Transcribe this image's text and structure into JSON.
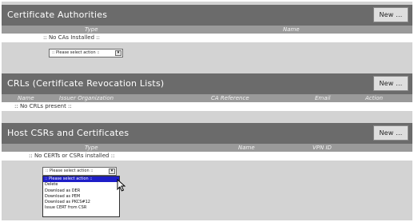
{
  "ca_section": {
    "title": "Certificate Authorities",
    "new_button": "New ...",
    "columns": [
      "Type",
      "Name"
    ],
    "empty_message": ":: No CAs Installed ::",
    "select_value": ":: Please select action ::"
  },
  "crl_section": {
    "title": "CRLs (Certificate Revocation Lists)",
    "new_button": "New ...",
    "columns": [
      "Name",
      "Issuer Organization",
      "CA Reference",
      "Email",
      "Action"
    ],
    "empty_message": ":: No CRLs present ::"
  },
  "host_section": {
    "title": "Host CSRs and Certificates",
    "new_button": "New ...",
    "columns": [
      "Type",
      "Name",
      "VPN ID"
    ],
    "empty_message": ":: No CERTs or CSRs installed ::",
    "select_value": ":: Please select action ::",
    "dropdown_options": [
      ":: Please select action ::",
      "Delete",
      "Download as DER",
      "Download as PEM",
      "Download as PKCS#12",
      "Issue CERT from CSR"
    ],
    "selected_option_index": 0
  },
  "icons": {
    "select_arrow": "chevron-down-icon",
    "cursor": "mouse-pointer-icon"
  },
  "colors": {
    "header_bg": "#6b6b6b",
    "column_row_bg": "#9a9a9a",
    "selected_option_bg": "#1e1ec8"
  }
}
